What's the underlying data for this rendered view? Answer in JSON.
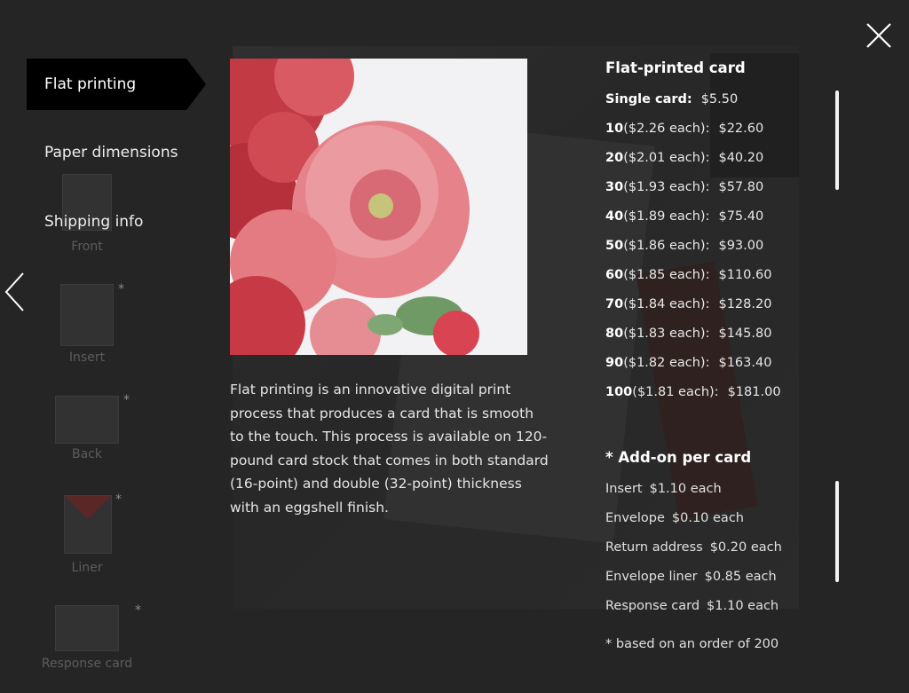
{
  "sidebar": {
    "active": "Flat printing",
    "items": [
      "Paper dimensions",
      "Shipping info"
    ],
    "thumbnails": [
      {
        "label": "Front",
        "star": ""
      },
      {
        "label": "Insert",
        "star": "*"
      },
      {
        "label": "Back",
        "star": "*"
      },
      {
        "label": "Liner",
        "star": "*"
      },
      {
        "label": "Response card",
        "star": "*"
      }
    ]
  },
  "description": "Flat printing is an innovative digital print process that produces a card that is smooth to the touch. This process is available on 120-pound card stock that comes in both standard (16-point) and double (32-point) thickness with an eggshell finish.",
  "pricing": {
    "title": "Flat-printed card",
    "single": {
      "label": "Single card:",
      "price": "$5.50"
    },
    "rows": [
      {
        "qty": "10",
        "each": "($2.26 each):",
        "total": "$22.60"
      },
      {
        "qty": "20",
        "each": "($2.01 each):",
        "total": "$40.20"
      },
      {
        "qty": "30",
        "each": "($1.93 each):",
        "total": "$57.80"
      },
      {
        "qty": "40",
        "each": "($1.89 each):",
        "total": "$75.40"
      },
      {
        "qty": "50",
        "each": "($1.86 each):",
        "total": "$93.00"
      },
      {
        "qty": "60",
        "each": "($1.85 each):",
        "total": "$110.60"
      },
      {
        "qty": "70",
        "each": "($1.84 each):",
        "total": "$128.20"
      },
      {
        "qty": "80",
        "each": "($1.83 each):",
        "total": "$145.80"
      },
      {
        "qty": "90",
        "each": "($1.82 each):",
        "total": "$163.40"
      },
      {
        "qty": "100",
        "each": "($1.81 each):",
        "total": "$181.00"
      }
    ]
  },
  "addons": {
    "title": "* Add-on per card",
    "rows": [
      {
        "name": "Insert",
        "price": "$1.10 each"
      },
      {
        "name": "Envelope",
        "price": "$0.10 each"
      },
      {
        "name": "Return address",
        "price": "$0.20 each"
      },
      {
        "name": "Envelope liner",
        "price": "$0.85 each"
      },
      {
        "name": "Response card",
        "price": "$1.10 each"
      }
    ],
    "footnote": "* based on an order of 200"
  },
  "icons": {
    "close": "close-icon",
    "prev": "chevron-left-icon"
  },
  "colors": {
    "background": "#2b2b2b",
    "active_tab": "#000000",
    "text": "#ffffff"
  }
}
